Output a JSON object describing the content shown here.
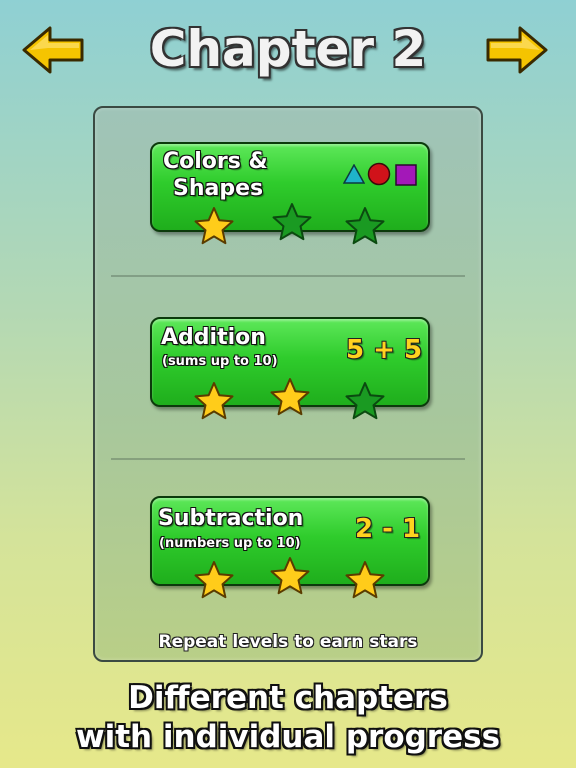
{
  "header": {
    "title": "Chapter 2",
    "prev_icon": "arrow-left-icon",
    "next_icon": "arrow-right-icon",
    "arrow_color": "#f5c400"
  },
  "panel": {
    "note": "Repeat levels to earn stars",
    "cards": [
      {
        "title_line1": "Colors &",
        "title_line2": "Shapes",
        "icons": [
          "triangle-icon",
          "circle-icon",
          "square-icon"
        ],
        "icon_colors": {
          "triangle": "#1fb3c9",
          "circle": "#d0121a",
          "square": "#a318b8"
        },
        "stars_earned": 1,
        "stars_total": 3
      },
      {
        "title": "Addition",
        "subtitle": "(sums up to 10)",
        "equation": "5 + 5",
        "stars_earned": 2,
        "stars_total": 3
      },
      {
        "title": "Subtraction",
        "subtitle": "(numbers up to 10)",
        "equation": "2 - 1",
        "stars_earned": 3,
        "stars_total": 3
      }
    ]
  },
  "caption": {
    "line1": "Different chapters",
    "line2": "with individual progress"
  },
  "colors": {
    "card_green": "#2fcc2c",
    "star_gold": "#ffcc1a",
    "star_empty": "#1a9a22"
  }
}
